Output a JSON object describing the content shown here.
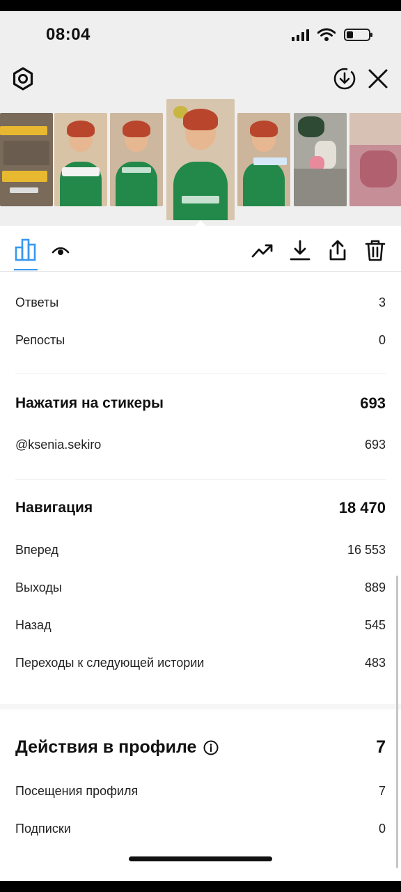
{
  "status_bar": {
    "time": "08:04"
  },
  "toolbar": {
    "settings_icon": "gear-icon",
    "download_icon": "download-circle-icon",
    "close_icon": "close-icon"
  },
  "thumbnails": [
    {
      "kind": "text-story",
      "selected": false
    },
    {
      "kind": "person",
      "selected": false
    },
    {
      "kind": "person",
      "selected": false
    },
    {
      "kind": "person",
      "selected": true
    },
    {
      "kind": "person",
      "selected": false
    },
    {
      "kind": "feet",
      "selected": false
    },
    {
      "kind": "pink",
      "selected": false
    }
  ],
  "tabs": [
    {
      "id": "stats",
      "icon": "bar-chart-icon",
      "active": true
    },
    {
      "id": "viewers",
      "icon": "eye-icon",
      "active": false
    }
  ],
  "actions": [
    {
      "id": "promote",
      "icon": "trending-up-icon"
    },
    {
      "id": "download",
      "icon": "download-icon"
    },
    {
      "id": "share",
      "icon": "share-icon"
    },
    {
      "id": "delete",
      "icon": "trash-icon"
    }
  ],
  "colors": {
    "accent": "#3897f0",
    "text": "#111111",
    "divider": "#ececec"
  },
  "stats": {
    "replies": {
      "label": "Ответы",
      "value": "3"
    },
    "reposts": {
      "label": "Репосты",
      "value": "0"
    },
    "sticker_taps": {
      "title": "Нажатия на стикеры",
      "total": "693",
      "items": [
        {
          "label": "@ksenia.sekiro",
          "value": "693"
        }
      ]
    },
    "navigation": {
      "title": "Навигация",
      "total": "18 470",
      "items": [
        {
          "label": "Вперед",
          "value": "16 553"
        },
        {
          "label": "Выходы",
          "value": "889"
        },
        {
          "label": "Назад",
          "value": "545"
        },
        {
          "label": "Переходы к следующей истории",
          "value": "483"
        }
      ]
    },
    "profile_actions": {
      "title": "Действия в профиле",
      "total": "7",
      "items": [
        {
          "label": "Посещения профиля",
          "value": "7"
        },
        {
          "label": "Подписки",
          "value": "0"
        }
      ]
    }
  }
}
